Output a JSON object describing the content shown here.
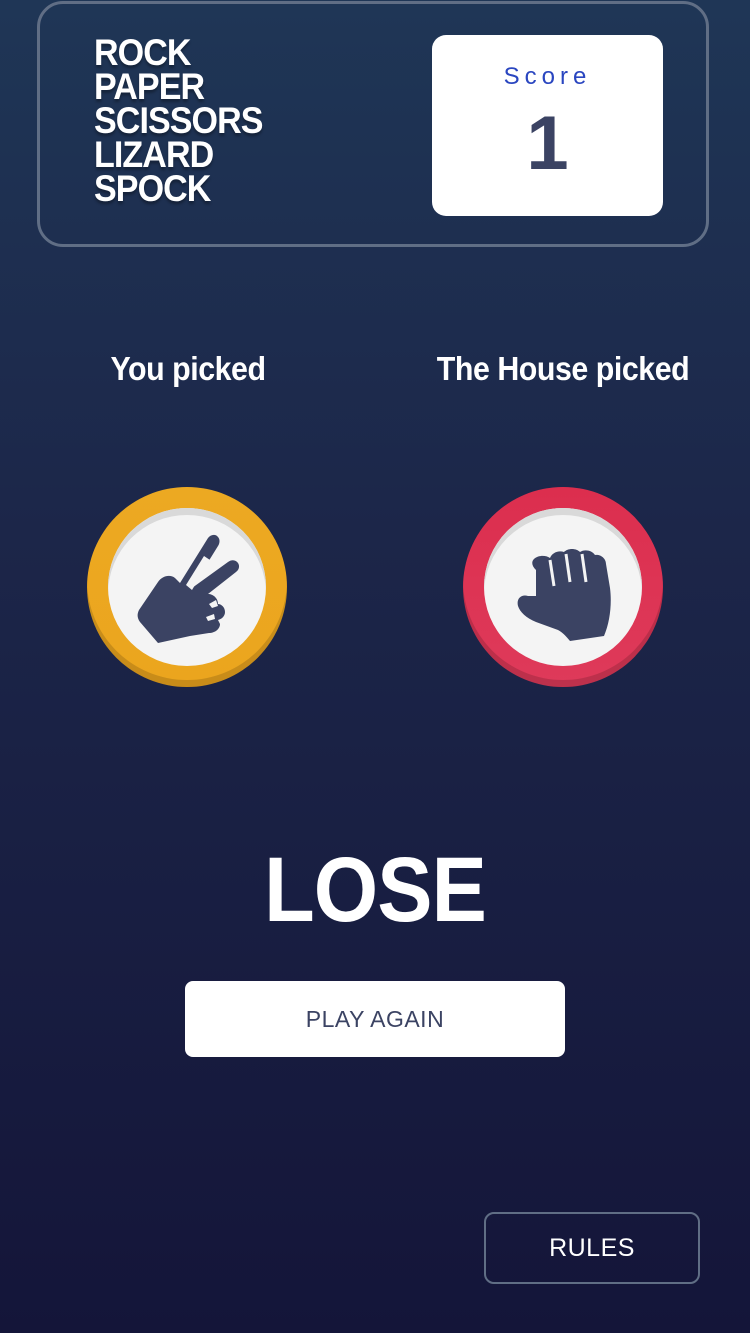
{
  "header": {
    "title_lines": [
      "ROCK",
      "PAPER",
      "SCISSORS",
      "LIZARD",
      "SPOCK"
    ],
    "score_label": "Score",
    "score_value": "1"
  },
  "game": {
    "you_label": "You picked",
    "house_label": "The House picked",
    "you_pick": "scissors",
    "house_pick": "rock",
    "you_icon": "scissors-hand-icon",
    "house_icon": "rock-fist-icon",
    "result": "LOSE",
    "play_again_label": "PLAY AGAIN"
  },
  "footer": {
    "rules_label": "RULES"
  },
  "colors": {
    "scissors_ring": "#eca922",
    "rock_ring": "#dc2e4e",
    "dark_text": "#3b4363",
    "score_label": "#2a46c0",
    "header_outline": "#606e85"
  }
}
